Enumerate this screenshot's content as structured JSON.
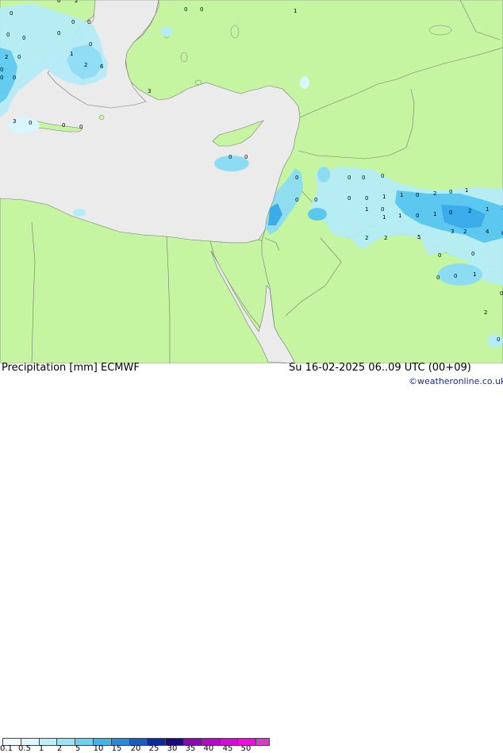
{
  "map": {
    "land_color": "#c5f5a0",
    "sea_color": "#ebebeb",
    "border_color": "#777777",
    "precip_colors": [
      "#d8f6fc",
      "#b4ecf8",
      "#8cdcf4",
      "#5cc8f0",
      "#3aacea"
    ]
  },
  "grid_values": [
    "0",
    "2",
    "0",
    "0",
    "1",
    "0",
    "0",
    "0",
    "0",
    "0",
    "0",
    "0",
    "1",
    "2",
    "0",
    "2",
    "6",
    "0",
    "0",
    "3",
    "3",
    "0",
    "0",
    "0",
    "0",
    "0",
    "0",
    "0",
    "0",
    "0",
    "0",
    "0",
    "0",
    "0",
    "1",
    "1",
    "0",
    "2",
    "0",
    "1",
    "1",
    "0",
    "1",
    "1",
    "0",
    "1",
    "0",
    "2",
    "1",
    "1",
    "3",
    "2",
    "4",
    "0",
    "2",
    "2",
    "5",
    "0",
    "0",
    "0",
    "0",
    "1",
    "0",
    "2",
    "0",
    "0"
  ],
  "footer": {
    "title": "Precipitation [mm]  ECMWF",
    "datetime": "Su 16-02-2025 06..09 UTC (00+09)",
    "credit": "©weatheronline.co.uk"
  },
  "legend": {
    "labels": [
      "0.1",
      "0.5",
      "1",
      "2",
      "5",
      "10",
      "15",
      "20",
      "25",
      "30",
      "35",
      "40",
      "45",
      "50"
    ],
    "colors": [
      "#f2fcff",
      "#dcf6fc",
      "#c0eef8",
      "#9ae2f4",
      "#6ed0ee",
      "#44b4e4",
      "#2a8ad8",
      "#1a5cc4",
      "#0a2aa0",
      "#1a0a80",
      "#8a0ab4",
      "#b40ac8",
      "#d80ad8",
      "#f00ae0",
      "#d040c8"
    ]
  }
}
